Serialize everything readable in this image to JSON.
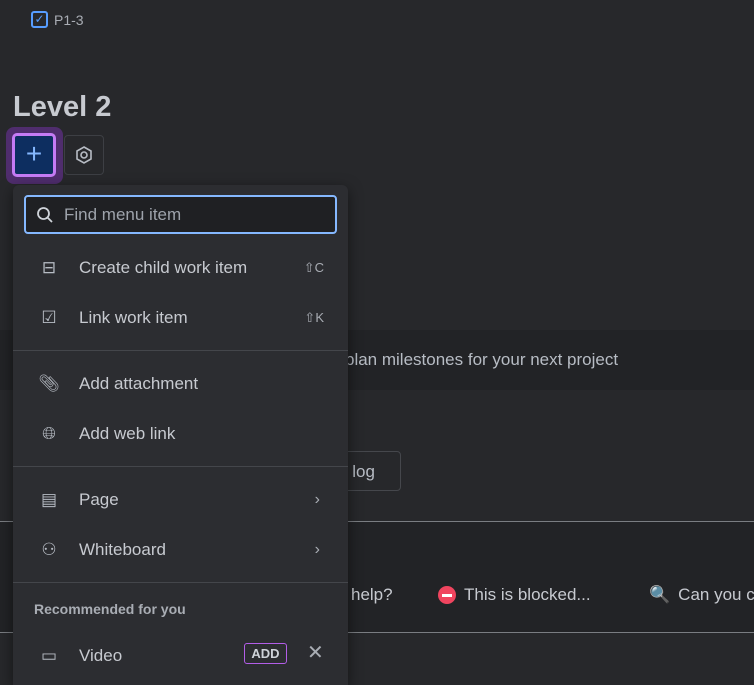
{
  "issue_key": "P1-3",
  "title": "Level 2",
  "banner_text": "plan milestones for your next project",
  "worklog_label": "k log",
  "comment_chips": [
    "help?",
    "This is blocked...",
    "Can you c"
  ],
  "menu": {
    "search_placeholder": "Find menu item",
    "items": [
      {
        "label": "Create child work item",
        "shortcut": "⇧C"
      },
      {
        "label": "Link work item",
        "shortcut": "⇧K"
      },
      {
        "label": "Add attachment"
      },
      {
        "label": "Add web link"
      },
      {
        "label": "Page"
      },
      {
        "label": "Whiteboard"
      }
    ],
    "recommended_heading": "Recommended for you",
    "recommended": [
      {
        "label": "Video",
        "action": "ADD"
      }
    ]
  }
}
